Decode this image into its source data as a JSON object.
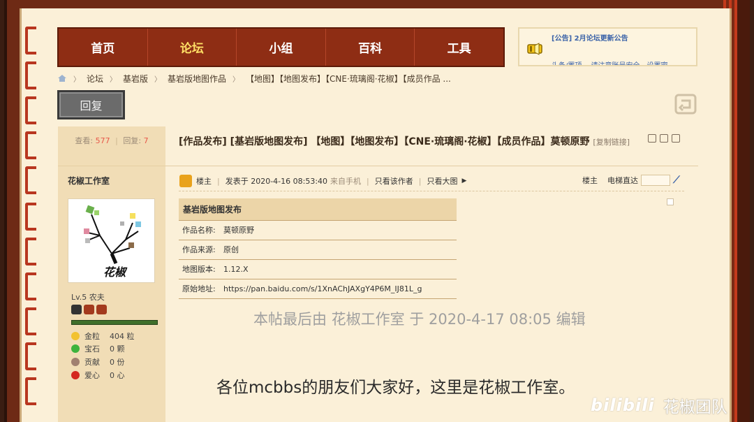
{
  "nav": {
    "items": [
      {
        "label": "首页",
        "active": false
      },
      {
        "label": "论坛",
        "active": true
      },
      {
        "label": "小组",
        "active": false
      },
      {
        "label": "百科",
        "active": false
      },
      {
        "label": "工具",
        "active": false
      }
    ]
  },
  "notice": {
    "line1": "[公告] 2月论坛更新公告",
    "line2": "头条/置顶… 请注意账号安全，设置密"
  },
  "breadcrumb": {
    "items": [
      "论坛",
      "基岩版",
      "基岩版地图作品",
      "【地图】【地图发布】【CNE·琉璃阁·花椒】【成员作品 ..."
    ]
  },
  "toolbar": {
    "reply_label": "回复"
  },
  "author": {
    "views_label": "查看:",
    "views": "577",
    "replies_label": "回复:",
    "replies": "7",
    "name": "花椒工作室",
    "avatar_text": "花椒",
    "level": "Lv.5 农夫",
    "stats": [
      {
        "label": "金粒",
        "value": "404 粒",
        "icon": "gold-nugget-icon",
        "color": "#f2c230"
      },
      {
        "label": "宝石",
        "value": "0 颗",
        "icon": "emerald-icon",
        "color": "#3db33d"
      },
      {
        "label": "贡献",
        "value": "0 份",
        "icon": "contribution-icon",
        "color": "#a08070"
      },
      {
        "label": "爱心",
        "value": "0 心",
        "icon": "heart-icon",
        "color": "#d4281e"
      }
    ]
  },
  "post": {
    "title": "[作品发布] [基岩版地图发布] 【地图】【地图发布】【CNE·琉璃阁·花椒】【成员作品】莫顿原野",
    "copy_link": "[复制链接]",
    "meta": {
      "owner_label": "楼主",
      "posted": "发表于 2020-4-16 08:53:40",
      "source": "来自手机",
      "only_author": "只看该作者",
      "large_image": "只看大图",
      "floor": "楼主",
      "jump": "电梯直达"
    },
    "table": {
      "header": "基岩版地图发布",
      "rows": [
        {
          "k": "作品名称:",
          "v": "莫顿原野"
        },
        {
          "k": "作品来源:",
          "v": "原创"
        },
        {
          "k": "地图版本:",
          "v": "1.12.X"
        },
        {
          "k": "原始地址:",
          "v": "https://pan.baidu.com/s/1XnAChJAXgY4P6M_IJ81L_g"
        }
      ]
    },
    "edit_note": "本帖最后由 花椒工作室 于 2020-4-17 08:05 编辑",
    "body": "各位mcbbs的朋友们大家好，这里是花椒工作室。"
  },
  "watermark": {
    "brand": "bilibili",
    "team": "花椒团队"
  },
  "colors": {
    "nav_bg": "#8e2d14",
    "nav_active": "#ffe066",
    "frame": "#6e2a15",
    "page": "#fbf0d8"
  }
}
